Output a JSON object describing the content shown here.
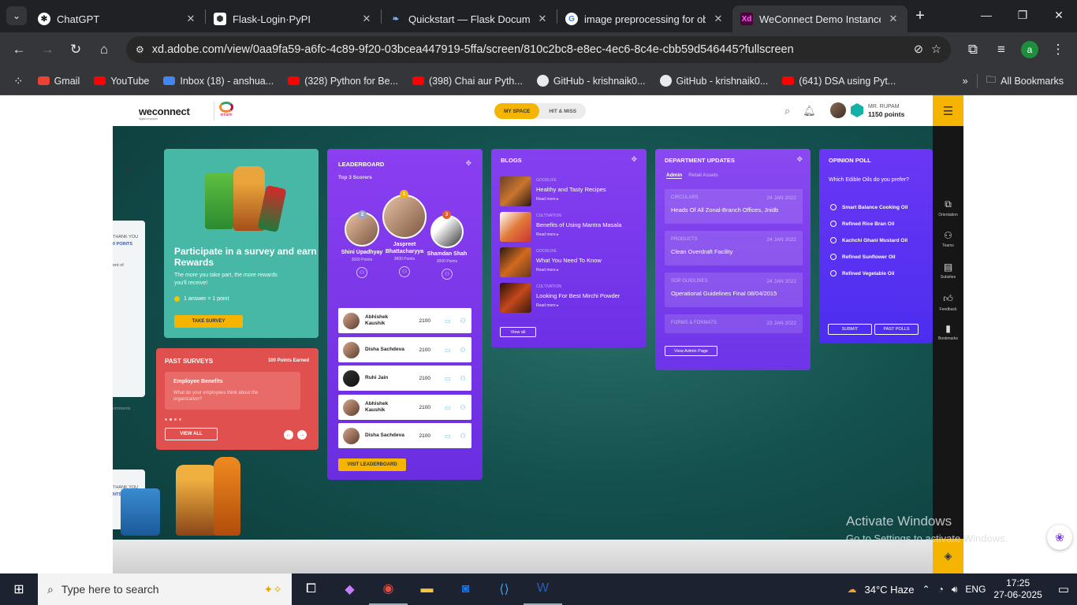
{
  "browser": {
    "tabs": [
      {
        "title": "ChatGPT",
        "active": false
      },
      {
        "title": "Flask-Login·PyPI",
        "active": false
      },
      {
        "title": "Quickstart — Flask Documer",
        "active": false
      },
      {
        "title": "image preprocessing for obj",
        "active": false
      },
      {
        "title": "WeConnect Demo Instance",
        "active": true
      }
    ],
    "url": "xd.adobe.com/view/0aa9fa59-a6fc-4c89-9f20-03bcea447919-5ffa/screen/810c2bc8-e8ec-4ec6-8c4e-cbb59d546445?fullscreen",
    "profile_initial": "a",
    "bookmarks": [
      "Gmail",
      "YouTube",
      "Inbox (18) - anshua...",
      "(328) Python for Be...",
      "(398) Chai aur Pyth...",
      "GitHub - krishnaik0...",
      "GitHub - krishnaik0...",
      "(641) DSA using Pyt..."
    ],
    "all_bookmarks": "All Bookmarks"
  },
  "app": {
    "logo": "weconnect",
    "logo_tag": "digital employee",
    "brand": "emami",
    "segments": {
      "my_space": "MY SPACE",
      "hit_miss": "HIT & MISS"
    },
    "user": {
      "name": "MR. RUPAM",
      "points": "1150 points"
    }
  },
  "ghost": {
    "a": "THANK YOU",
    "b": "0 POINTS",
    "c": "ent of",
    "d": "omments",
    "e": "THANK YOU",
    "f": "NTS EACH",
    "dots": "•••"
  },
  "survey": {
    "title": "Participate in a survey and earn Rewards",
    "desc": "The more you take part, the more rewards you'll receive!",
    "rate": "1 answer = 1 point",
    "button": "TAKE SURVEY"
  },
  "past_surveys": {
    "title": "PAST SURVEYS",
    "earned": "100 Points Earned",
    "item_title": "Employee Benefits",
    "item_desc": "What do your employees think about the organization?",
    "view_all": "VIEW ALL"
  },
  "leaderboard": {
    "title": "LEADERBOARD",
    "subtitle": "Top 3 Scorers",
    "top3": [
      {
        "name": "Shini Upadhyay",
        "points": "3000 Points",
        "rank": "2"
      },
      {
        "name": "Jaspreet Bhattacharyya",
        "points": "3800 Points",
        "rank": "1"
      },
      {
        "name": "Shamdan Shah",
        "points": "3000 Points",
        "rank": "3"
      }
    ],
    "rows": [
      {
        "name": "Abhishek Kaushik",
        "score": "2100"
      },
      {
        "name": "Disha Sachdeva",
        "score": "2100"
      },
      {
        "name": "Ruhi Jain",
        "score": "2100"
      },
      {
        "name": "Abhishek Kaushik",
        "score": "2100"
      },
      {
        "name": "Disha Sachdeva",
        "score": "2100"
      }
    ],
    "button": "VISIT LEADERBOARD"
  },
  "blogs": {
    "title": "BLOGS",
    "posts": [
      {
        "cat": "GOODLIFE",
        "title": "Healthy and Tasty Recipes",
        "more": "Read more ▸"
      },
      {
        "cat": "CULTIVATION",
        "title": "Benefits of Using Mantra Masala",
        "more": "Read more ▸"
      },
      {
        "cat": "GOODLIFE",
        "title": "What You Need To Know",
        "more": "Read more ▸"
      },
      {
        "cat": "CULTIVATION",
        "title": "Looking For Best Mirchi Powder",
        "more": "Read more ▸"
      }
    ],
    "button": "View all"
  },
  "department": {
    "title": "DEPARTMENT UPDATES",
    "tabs": [
      "Admin",
      "Retail Assets"
    ],
    "items": [
      {
        "kind": "CIRCULARS",
        "date": "24 JAN 2022",
        "text": "Heads Of All Zonal-Branch Offices, Jnidb"
      },
      {
        "kind": "PRODUCTS",
        "date": "24 JAN 2022",
        "text": "Clean Overdraft Facility"
      },
      {
        "kind": "SOP GUIDLINES",
        "date": "24 JAN 2022",
        "text": "Operational Guidelines Final 08/04/2015"
      },
      {
        "kind": "FORMS & FORMATS",
        "date": "23 JAN 2022",
        "text": ""
      }
    ],
    "button": "View Admin Page"
  },
  "poll": {
    "title": "OPINION POLL",
    "question": "Which Edible Oils do you prefer?",
    "options": [
      "Smart Balance Cooking Oil",
      "Refined Rice Bran Oil",
      "Kachchi Ghani Mustard Oil",
      "Refined Sunflower Oil",
      "Refined Vegetable Oil"
    ],
    "submit": "SUBMIT",
    "past": "PAST POLLS"
  },
  "rail": [
    "Orientation",
    "Teams",
    "Subsites",
    "Feedback",
    "Bookmarks"
  ],
  "watermark": {
    "title": "Activate Windows",
    "sub": "Go to Settings to activate Windows."
  },
  "taskbar": {
    "search_placeholder": "Type here to search",
    "weather": "34°C  Haze",
    "lang": "ENG",
    "time": "17:25",
    "date": "27-06-2025"
  }
}
